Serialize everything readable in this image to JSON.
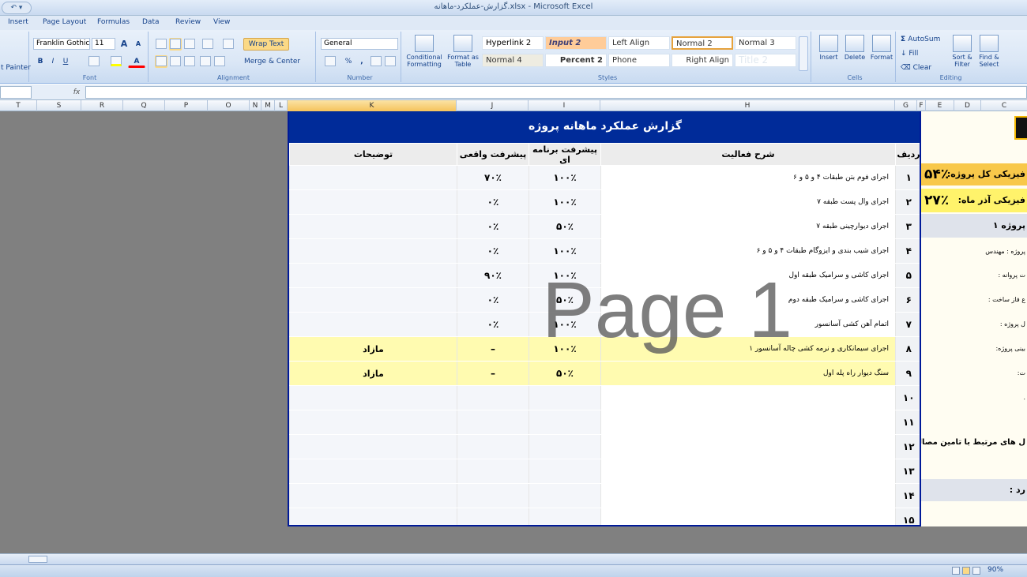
{
  "window": {
    "title": "گزارش-عملکرد-ماهانه.xlsx - Microsoft Excel",
    "qat_label": "↶ ▾"
  },
  "tabs": [
    "Insert",
    "Page Layout",
    "Formulas",
    "Data",
    "Review",
    "View"
  ],
  "ribbon": {
    "clipboard": {
      "format_painter": "t Painter"
    },
    "font": {
      "group_label": "Font",
      "font_name": "Franklin Gothic",
      "font_size": "11",
      "bold": "B",
      "italic": "I",
      "underline": "U",
      "grow": "A",
      "shrink": "A"
    },
    "alignment": {
      "group_label": "Alignment",
      "wrap_text": "Wrap Text",
      "merge_center": "Merge & Center"
    },
    "number": {
      "group_label": "Number",
      "format": "General",
      "percent": "%",
      "comma": ","
    },
    "styles": {
      "group_label": "Styles",
      "conditional_formatting": "Conditional Formatting",
      "format_as_table": "Format as Table",
      "cells": [
        "Hyperlink 2",
        "Input 2",
        "Left Align",
        "Normal 2",
        "Normal 3",
        "Normal 4",
        "Percent 2",
        "Phone",
        "Right Align",
        "Title 2"
      ]
    },
    "cells_group": {
      "group_label": "Cells",
      "insert": "Insert",
      "delete": "Delete",
      "format": "Format"
    },
    "editing": {
      "group_label": "Editing",
      "autosum": "AutoSum",
      "fill": "Fill",
      "clear": "Clear",
      "sort_filter": "Sort & Filter",
      "find_select": "Find & Select"
    }
  },
  "formula_bar": {
    "fx": "fx",
    "value": ""
  },
  "columns": [
    "T",
    "S",
    "R",
    "Q",
    "P",
    "O",
    "N",
    "M",
    "L",
    "K",
    "J",
    "I",
    "H",
    "G",
    "F",
    "E",
    "D",
    "C"
  ],
  "report": {
    "title": "گزارش عملکرد ماهانه پروژه",
    "headers": {
      "row": "ردیف",
      "description": "شرح فعالیت",
      "planned": "پیشرفت برنامه ای",
      "actual": "پیشرفت واقعی",
      "notes": "توضیحات"
    },
    "rows": [
      {
        "num": "۱",
        "desc": "اجرای فوم بتن طبقات ۴ و ۵ و ۶",
        "planned": "۱۰۰٪",
        "actual": "۷۰٪",
        "notes": "",
        "highlight": false
      },
      {
        "num": "۲",
        "desc": "اجرای وال پست طبقه ۷",
        "planned": "۱۰۰٪",
        "actual": "۰٪",
        "notes": "",
        "highlight": false
      },
      {
        "num": "۳",
        "desc": "اجرای دیوارچینی طبقه ۷",
        "planned": "۵۰٪",
        "actual": "۰٪",
        "notes": "",
        "highlight": false
      },
      {
        "num": "۴",
        "desc": "اجرای شیب بندی و ایزوگام طبقات ۴ و ۵ و ۶",
        "planned": "۱۰۰٪",
        "actual": "۰٪",
        "notes": "",
        "highlight": false
      },
      {
        "num": "۵",
        "desc": "اجرای کاشی و سرامیک طبقه اول",
        "planned": "۱۰۰٪",
        "actual": "۹۰٪",
        "notes": "",
        "highlight": false
      },
      {
        "num": "۶",
        "desc": "اجرای کاشی و سرامیک طبقه دوم",
        "planned": "۵۰٪",
        "actual": "۰٪",
        "notes": "",
        "highlight": false
      },
      {
        "num": "۷",
        "desc": "اتمام آهن کشی آسانسور",
        "planned": "۱۰۰٪",
        "actual": "۰٪",
        "notes": "",
        "highlight": false
      },
      {
        "num": "۸",
        "desc": "اجرای سیمانکاری و نرمه کشی چاله آسانسور ۱",
        "planned": "۱۰۰٪",
        "actual": "–",
        "notes": "مازاد",
        "highlight": true
      },
      {
        "num": "۹",
        "desc": "سنگ دیوار راه پله اول",
        "planned": "۵۰٪",
        "actual": "–",
        "notes": "مازاد",
        "highlight": true
      },
      {
        "num": "۱۰",
        "desc": "",
        "planned": "",
        "actual": "",
        "notes": "",
        "highlight": false
      },
      {
        "num": "۱۱",
        "desc": "",
        "planned": "",
        "actual": "",
        "notes": "",
        "highlight": false
      },
      {
        "num": "۱۲",
        "desc": "",
        "planned": "",
        "actual": "",
        "notes": "",
        "highlight": false
      },
      {
        "num": "۱۳",
        "desc": "",
        "planned": "",
        "actual": "",
        "notes": "",
        "highlight": false
      },
      {
        "num": "۱۴",
        "desc": "",
        "planned": "",
        "actual": "",
        "notes": "",
        "highlight": false
      },
      {
        "num": "۱۵",
        "desc": "",
        "planned": "",
        "actual": "",
        "notes": "",
        "highlight": false
      }
    ],
    "watermark": "Page 1"
  },
  "side_panel": {
    "row1_label": "فیزیکی کل پروژه:",
    "row1_value": "۵۴٪",
    "row2_label": "فیزیکی آذر ماه:",
    "row2_value": "۲۷٪",
    "row3_label": "پروژه ۱",
    "items": [
      "پروژه : مهندس",
      "ت پروانه :",
      "ع فاز ساخت :",
      "ل پروژه :",
      "بینی پروژه:",
      "ت:",
      "."
    ],
    "row12_label": "ل های مرتبط با تامین مصالح :",
    "row14_label": "رد :"
  },
  "status": {
    "zoom": "90%"
  },
  "colors": {
    "title_bg": "#002b99",
    "highlight": "#fffbb0",
    "sheet_bg": "#808080"
  }
}
